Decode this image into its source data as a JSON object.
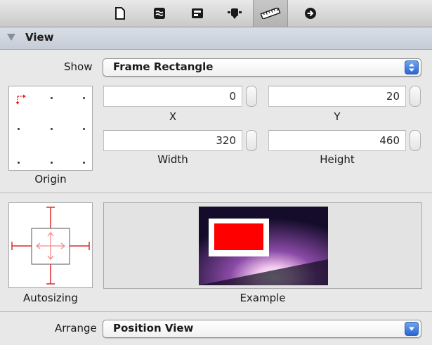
{
  "toolbar": {
    "tabs": [
      {
        "name": "document-icon"
      },
      {
        "name": "connections-icon"
      },
      {
        "name": "attributes-icon"
      },
      {
        "name": "bindings-icon"
      },
      {
        "name": "ruler-icon",
        "selected": true
      },
      {
        "name": "arrow-circle-icon"
      }
    ]
  },
  "section": {
    "title": "View"
  },
  "show": {
    "label": "Show",
    "value": "Frame Rectangle"
  },
  "frame": {
    "x": "0",
    "x_label": "X",
    "y": "20",
    "y_label": "Y",
    "width": "320",
    "width_label": "Width",
    "height": "460",
    "height_label": "Height"
  },
  "origin": {
    "label": "Origin"
  },
  "autosizing": {
    "label": "Autosizing",
    "strut_color": "#e0282a"
  },
  "example": {
    "label": "Example",
    "fill_color": "#ff0000"
  },
  "arrange": {
    "label": "Arrange",
    "value": "Position View"
  },
  "colors": {
    "accent": "#2a64d2",
    "header_bg": "#cbd1da"
  }
}
